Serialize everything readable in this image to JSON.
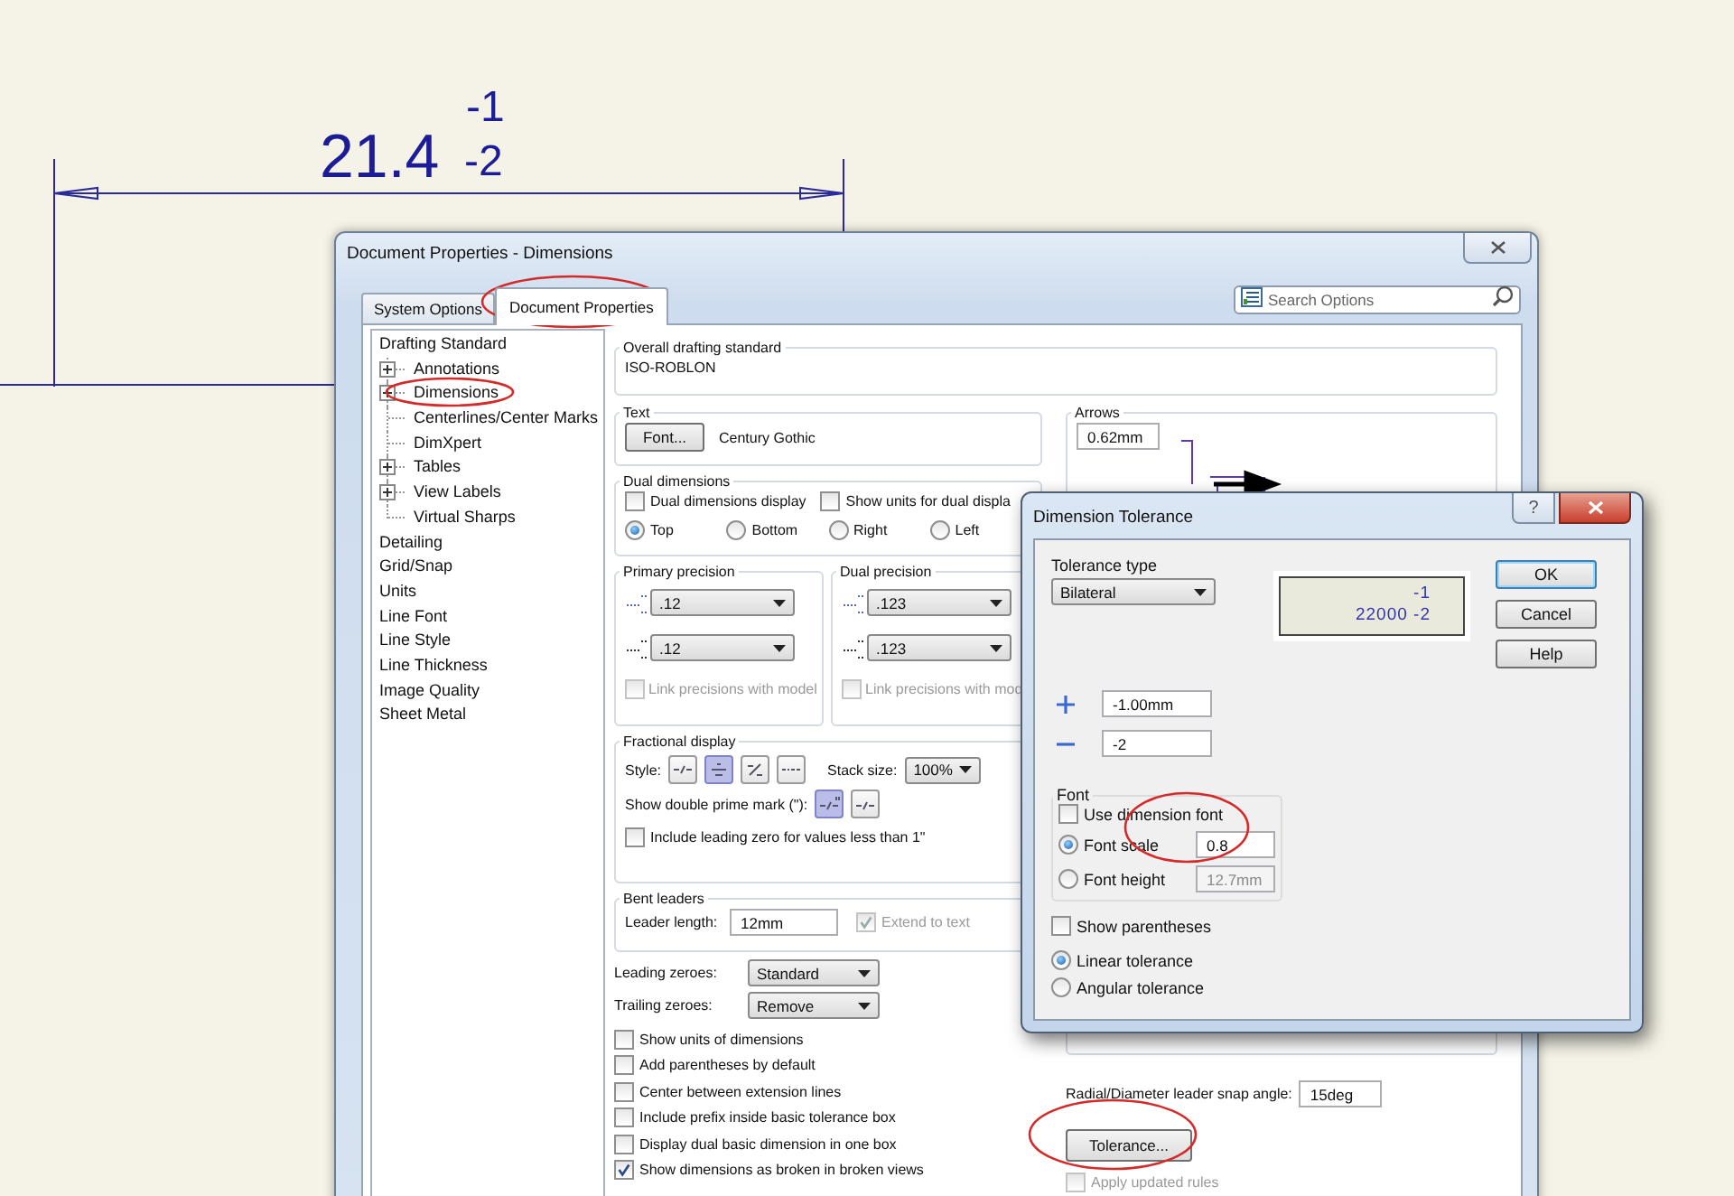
{
  "drawing": {
    "value": "21.4",
    "upper": "-1",
    "lower": "-2"
  },
  "window": {
    "title": "Document Properties - Dimensions",
    "tabs": [
      {
        "label": "System Options",
        "selected": false
      },
      {
        "label": "Document Properties",
        "selected": true
      }
    ],
    "search": {
      "placeholder": "Search Options"
    },
    "tree": [
      {
        "label": "Drafting Standard",
        "children": [
          {
            "label": "Annotations",
            "expandable": true
          },
          {
            "label": "Dimensions",
            "expandable": true
          },
          {
            "label": "Centerlines/Center Marks",
            "expandable": false
          },
          {
            "label": "DimXpert",
            "expandable": false
          },
          {
            "label": "Tables",
            "expandable": true
          },
          {
            "label": "View Labels",
            "expandable": true
          },
          {
            "label": "Virtual Sharps",
            "expandable": false
          }
        ]
      },
      {
        "label": "Detailing"
      },
      {
        "label": "Grid/Snap"
      },
      {
        "label": "Units"
      },
      {
        "label": "Line Font"
      },
      {
        "label": "Line Style"
      },
      {
        "label": "Line Thickness"
      },
      {
        "label": "Image Quality"
      },
      {
        "label": "Sheet Metal"
      }
    ],
    "overall_standard": {
      "label": "Overall drafting standard",
      "value": "ISO-ROBLON"
    },
    "text": {
      "label": "Text",
      "button": "Font...",
      "font": "Century Gothic"
    },
    "dual_dimensions": {
      "label": "Dual dimensions",
      "checkboxes": [
        {
          "label": "Dual dimensions display",
          "checked": false
        },
        {
          "label": "Show units for dual displa",
          "checked": false
        }
      ],
      "positions": [
        {
          "label": "Top",
          "selected": true
        },
        {
          "label": "Bottom",
          "selected": false
        },
        {
          "label": "Right",
          "selected": false
        },
        {
          "label": "Left",
          "selected": false
        }
      ]
    },
    "precisions": [
      {
        "label": "Primary precision",
        "value": ".12",
        "tolerance": ".12",
        "link": {
          "label": "Link precisions with model",
          "checked": false,
          "disabled": true
        }
      },
      {
        "label": "Dual precision",
        "value": ".123",
        "tolerance": ".123",
        "link": {
          "label": "Link precisions with mod",
          "checked": false,
          "disabled": true
        }
      }
    ],
    "fractional": {
      "label": "Fractional display",
      "style_label": "Style:",
      "styles": [
        {
          "selected": false
        },
        {
          "selected": true
        },
        {
          "selected": false
        },
        {
          "selected": false
        }
      ],
      "stack_label": "Stack size:",
      "stack_size": "100%",
      "prime_label": "Show double prime mark (\"):",
      "prime_styles": [
        {
          "selected": true
        },
        {
          "selected": false
        }
      ],
      "leading_zero": {
        "label": "Include leading zero for values less than 1\"",
        "checked": false
      }
    },
    "bent_leaders": {
      "label": "Bent leaders",
      "length_label": "Leader length:",
      "length": "12mm",
      "extend": {
        "label": "Extend to text",
        "checked": true,
        "disabled": true
      }
    },
    "zeroes": [
      {
        "label": "Leading zeroes:",
        "value": "Standard"
      },
      {
        "label": "Trailing zeroes:",
        "value": "Remove"
      }
    ],
    "options": [
      {
        "label": "Show units of dimensions",
        "checked": false
      },
      {
        "label": "Add parentheses by default",
        "checked": false
      },
      {
        "label": "Center between extension lines",
        "checked": false
      },
      {
        "label": "Include prefix inside basic tolerance box",
        "checked": false
      },
      {
        "label": "Display dual basic dimension in one box",
        "checked": false
      },
      {
        "label": "Show dimensions as broken in broken views",
        "checked": true
      }
    ],
    "arrows": {
      "label": "Arrows",
      "size": "0.62mm"
    },
    "snap_angle": {
      "label": "Radial/Diameter leader snap angle:",
      "value": "15deg"
    },
    "tolerance_button": "Tolerance...",
    "apply_rules": {
      "label": "Apply updated rules",
      "checked": false,
      "disabled": true
    }
  },
  "tolerance_dialog": {
    "title": "Dimension Tolerance",
    "help_glyph": "?",
    "type_label": "Tolerance type",
    "type": "Bilateral",
    "preview": {
      "upper": "-1",
      "value": "22000",
      "lower": "-2"
    },
    "buttons": [
      "OK",
      "Cancel",
      "Help"
    ],
    "plus": "-1.00mm",
    "minus": "-2",
    "font": {
      "label": "Font",
      "use_dimension_font": {
        "label": "Use dimension font",
        "checked": false
      },
      "modes": [
        {
          "label": "Font scale",
          "selected": true,
          "value": "0.8"
        },
        {
          "label": "Font height",
          "selected": false,
          "value": "12.7mm"
        }
      ]
    },
    "show_parentheses": {
      "label": "Show parentheses",
      "checked": false
    },
    "units": [
      {
        "label": "Linear tolerance",
        "selected": true
      },
      {
        "label": "Angular tolerance",
        "selected": false
      }
    ]
  }
}
